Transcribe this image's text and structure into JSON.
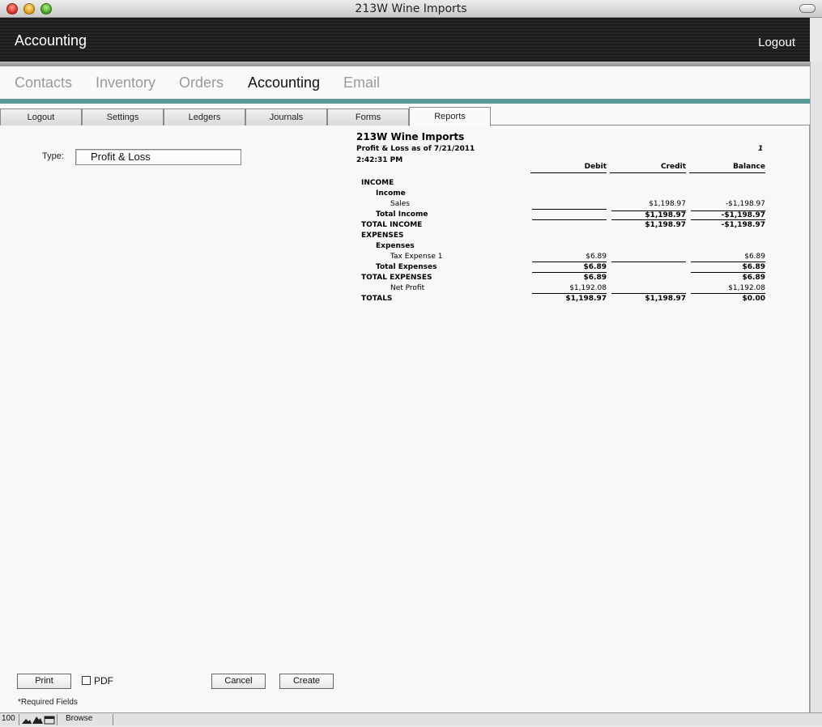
{
  "window": {
    "title": "213W Wine Imports"
  },
  "header": {
    "title": "Accounting",
    "logout": "Logout"
  },
  "mainnav": [
    "Contacts",
    "Inventory",
    "Orders",
    "Accounting",
    "Email"
  ],
  "subtabs": [
    "Logout",
    "Settings",
    "Ledgers",
    "Journals",
    "Forms",
    "Reports"
  ],
  "form": {
    "type_label": "Type:",
    "type_value": "Profit & Loss"
  },
  "report": {
    "company": "213W Wine Imports",
    "subtitle": "Profit & Loss as of 7/21/2011",
    "time": "2:42:31 PM",
    "page": "1",
    "columns": [
      "Debit",
      "Credit",
      "Balance"
    ],
    "rows": [
      {
        "label": "INCOME",
        "debit": "",
        "credit": "",
        "balance": ""
      },
      {
        "label": "Income",
        "debit": "",
        "credit": "",
        "balance": ""
      },
      {
        "label": "Sales",
        "debit": "",
        "credit": "$1,198.97",
        "balance": "-$1,198.97"
      },
      {
        "label": "Total Income",
        "debit": "",
        "credit": "$1,198.97",
        "balance": "-$1,198.97"
      },
      {
        "label": "TOTAL INCOME",
        "debit": "",
        "credit": "$1,198.97",
        "balance": "-$1,198.97"
      },
      {
        "label": "EXPENSES",
        "debit": "",
        "credit": "",
        "balance": ""
      },
      {
        "label": "Expenses",
        "debit": "",
        "credit": "",
        "balance": ""
      },
      {
        "label": "Tax Expense 1",
        "debit": "$6.89",
        "credit": "",
        "balance": "$6.89"
      },
      {
        "label": "Total Expenses",
        "debit": "$6.89",
        "credit": "",
        "balance": "$6.89"
      },
      {
        "label": "TOTAL EXPENSES",
        "debit": "$6.89",
        "credit": "",
        "balance": "$6.89"
      },
      {
        "label": "Net Profit",
        "debit": "$1,192.08",
        "credit": "",
        "balance": "$1,192.08"
      },
      {
        "label": "TOTALS",
        "debit": "$1,198.97",
        "credit": "$1,198.97",
        "balance": "$0.00"
      }
    ]
  },
  "buttons": {
    "print": "Print",
    "pdf": "PDF",
    "cancel": "Cancel",
    "create": "Create"
  },
  "required_note": "*Required Fields",
  "status": {
    "zoom": "100",
    "mode": "Browse"
  }
}
